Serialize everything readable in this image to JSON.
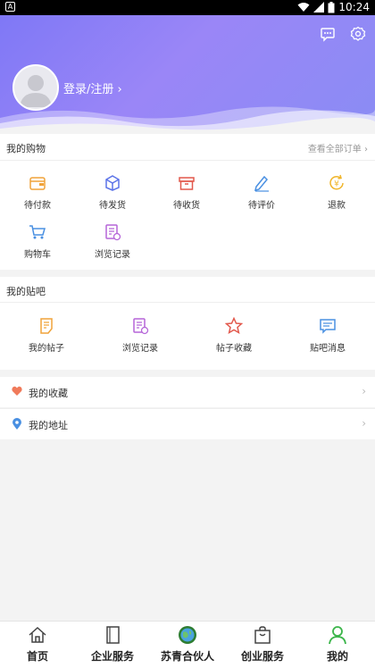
{
  "status_bar": {
    "time": "10:24",
    "left_badge": "A"
  },
  "header": {
    "login_label": "登录/注册"
  },
  "shopping": {
    "title": "我的购物",
    "view_all": "查看全部订单",
    "items": [
      {
        "label": "待付款",
        "icon": "wallet-icon"
      },
      {
        "label": "待发货",
        "icon": "package-icon"
      },
      {
        "label": "待收货",
        "icon": "box-icon"
      },
      {
        "label": "待评价",
        "icon": "pen-icon"
      },
      {
        "label": "退款",
        "icon": "refund-icon"
      },
      {
        "label": "购物车",
        "icon": "cart-icon"
      },
      {
        "label": "浏览记录",
        "icon": "history-icon"
      }
    ]
  },
  "forum": {
    "title": "我的贴吧",
    "items": [
      {
        "label": "我的帖子",
        "icon": "note-icon"
      },
      {
        "label": "浏览记录",
        "icon": "history-icon"
      },
      {
        "label": "帖子收藏",
        "icon": "star-icon"
      },
      {
        "label": "贴吧消息",
        "icon": "message-icon"
      }
    ]
  },
  "list": [
    {
      "label": "我的收藏",
      "icon": "heart-icon"
    },
    {
      "label": "我的地址",
      "icon": "location-icon"
    }
  ],
  "bottom_nav": {
    "items": [
      {
        "label": "首页",
        "icon": "home-icon"
      },
      {
        "label": "企业服务",
        "icon": "book-icon"
      },
      {
        "label": "苏青合伙人",
        "icon": "globe-logo-icon"
      },
      {
        "label": "创业服务",
        "icon": "bag-icon"
      },
      {
        "label": "我的",
        "icon": "person-icon",
        "active": true
      }
    ],
    "active_color": "#3bb54a"
  },
  "colors": {
    "accent": "#8a80f6"
  }
}
